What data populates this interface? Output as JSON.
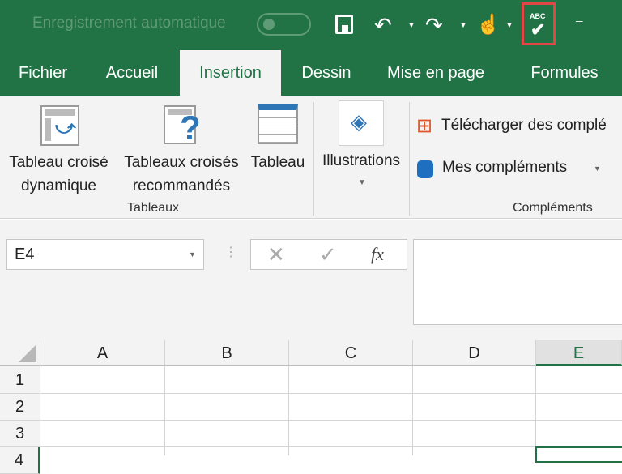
{
  "title_bar": {
    "autosave_label": "Enregistrement automatique",
    "autosave_state": "off",
    "spellcheck_label": "ABC"
  },
  "tabs": [
    {
      "label": "Fichier"
    },
    {
      "label": "Accueil"
    },
    {
      "label": "Insertion",
      "active": true
    },
    {
      "label": "Dessin"
    },
    {
      "label": "Mise en page"
    },
    {
      "label": "Formules"
    }
  ],
  "ribbon": {
    "tableaux": {
      "group_label": "Tableaux",
      "pivot_line1": "Tableau croisé",
      "pivot_line2": "dynamique",
      "recommended_line1": "Tableaux croisés",
      "recommended_line2": "recommandés",
      "table": "Tableau"
    },
    "illustrations": {
      "label": "Illustrations"
    },
    "complements": {
      "group_label": "Compléments",
      "download": "Télécharger des complé",
      "my_addins": "Mes compléments"
    }
  },
  "formula_bar": {
    "name_box": "E4",
    "fx": "fx",
    "formula": ""
  },
  "sheet": {
    "columns": [
      "A",
      "B",
      "C",
      "D",
      "E"
    ],
    "rows": [
      "1",
      "2",
      "3",
      "4"
    ],
    "selected_column": "E",
    "accent": "#217346"
  }
}
